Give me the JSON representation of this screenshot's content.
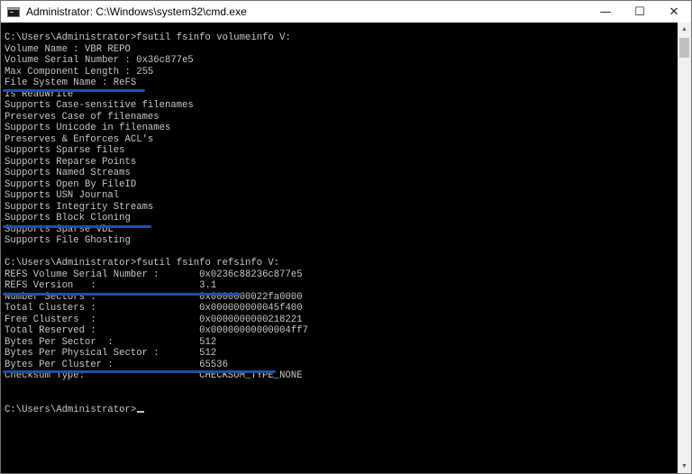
{
  "window": {
    "title": "Administrator: C:\\Windows\\system32\\cmd.exe",
    "icon": "cmd-icon",
    "controls": {
      "minimize": "—",
      "maximize": "☐",
      "close": "✕"
    }
  },
  "console": {
    "text_color": "#c8c8c8",
    "background": "#000000",
    "lines": [
      "C:\\Users\\Administrator>fsutil fsinfo volumeinfo V:",
      "Volume Name : VBR REPO",
      "Volume Serial Number : 0x36c877e5",
      "Max Component Length : 255",
      "File System Name : ReFS",
      "Is ReadWrite",
      "Supports Case-sensitive filenames",
      "Preserves Case of filenames",
      "Supports Unicode in filenames",
      "Preserves & Enforces ACL's",
      "Supports Sparse files",
      "Supports Reparse Points",
      "Supports Named Streams",
      "Supports Open By FileID",
      "Supports USN Journal",
      "Supports Integrity Streams",
      "Supports Block Cloning",
      "Supports Sparse VDL",
      "Supports File Ghosting",
      "",
      "C:\\Users\\Administrator>fsutil fsinfo refsinfo V:",
      "REFS Volume Serial Number :       0x0236c88236c877e5",
      "REFS Version   :                  3.1",
      "Number Sectors :                  0x0000000022fa0000",
      "Total Clusters :                  0x000000000045f400",
      "Free Clusters  :                  0x0000000000218221",
      "Total Reserved :                  0x00000000000004ff7",
      "Bytes Per Sector  :               512",
      "Bytes Per Physical Sector :       512",
      "Bytes Per Cluster :               65536",
      "Checksum Type:                    CHECKSUM_TYPE_NONE",
      "",
      "",
      "C:\\Users\\Administrator>"
    ]
  },
  "annotations": {
    "color": "#1e4fa8"
  },
  "scrollbar": {
    "up_arrow": "▲",
    "down_arrow": "▼"
  }
}
